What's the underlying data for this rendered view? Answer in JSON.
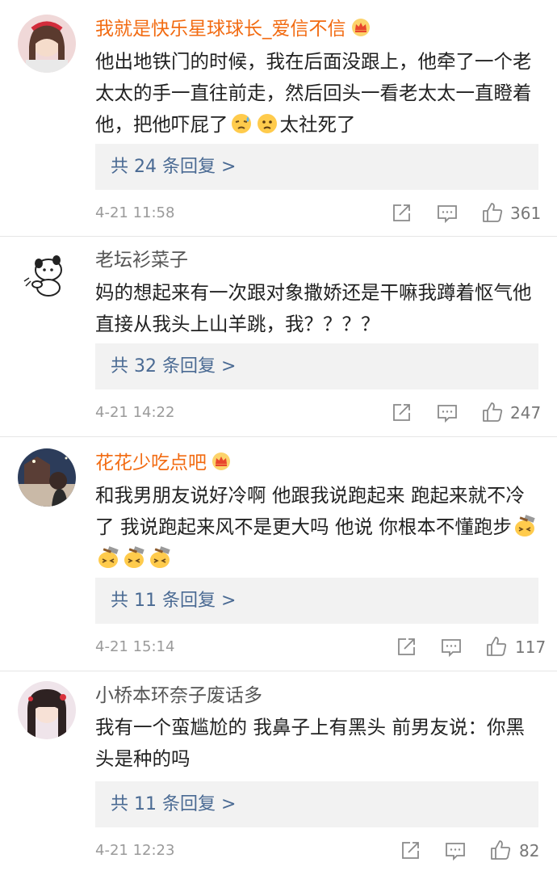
{
  "comments": [
    {
      "username": "我就是快乐星球球长_爱信不信",
      "vip": true,
      "text_before": "他出地铁门的时候，我在后面没跟上，他牵了一个老太太的手一直往前走，然后回头一看老太太一直瞪着他，把他吓屁了",
      "emojis": [
        "sweat-face-emoji",
        "worried-face-emoji"
      ],
      "text_after": "太社死了",
      "replies_label": "共 24 条回复 >",
      "time": "4-21 11:58",
      "likes": "361"
    },
    {
      "username": "老坛衫菜子",
      "vip": false,
      "text": "妈的想起来有一次跟对象撒娇还是干嘛我蹲着怄气他直接从我头上山羊跳，我？？？？",
      "replies_label": "共 32 条回复 >",
      "time": "4-21 14:22",
      "likes": "247"
    },
    {
      "username": "花花少吃点吧",
      "vip": true,
      "text": "和我男朋友说好冷啊 他跟我说跑起来 跑起来就不冷了 我说跑起来风不是更大吗 他说 你根本不懂跑步",
      "emojis": [
        "hammer-face-emoji",
        "hammer-face-emoji",
        "hammer-face-emoji",
        "hammer-face-emoji"
      ],
      "replies_label": "共 11 条回复 >",
      "time": "4-21 15:14",
      "likes": "117"
    },
    {
      "username": "小桥本环奈子废话多",
      "vip": false,
      "text": "我有一个蛮尴尬的 我鼻子上有黑头 前男友说：你黑头是种的吗",
      "replies_label": "共 11 条回复 >",
      "time": "4-21 12:23",
      "likes": "82"
    }
  ],
  "colors": {
    "vip_name": "#f26b12",
    "plain_name": "#555555",
    "reply_link": "#4a6a93",
    "reply_bg": "#f2f2f2",
    "meta": "#9a9a9a"
  },
  "icons": {
    "share": "share-icon",
    "comment": "comment-icon",
    "like": "thumbs-up-icon",
    "vip_badge": "crown-badge-icon"
  }
}
